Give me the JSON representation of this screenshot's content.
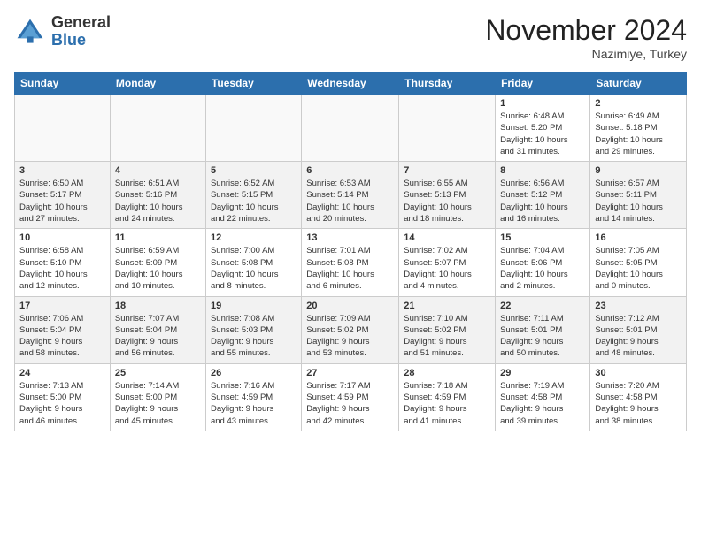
{
  "header": {
    "logo_line1": "General",
    "logo_line2": "Blue",
    "month_year": "November 2024",
    "location": "Nazimiye, Turkey"
  },
  "weekdays": [
    "Sunday",
    "Monday",
    "Tuesday",
    "Wednesday",
    "Thursday",
    "Friday",
    "Saturday"
  ],
  "weeks": [
    [
      {
        "day": "",
        "info": ""
      },
      {
        "day": "",
        "info": ""
      },
      {
        "day": "",
        "info": ""
      },
      {
        "day": "",
        "info": ""
      },
      {
        "day": "",
        "info": ""
      },
      {
        "day": "1",
        "info": "Sunrise: 6:48 AM\nSunset: 5:20 PM\nDaylight: 10 hours\nand 31 minutes."
      },
      {
        "day": "2",
        "info": "Sunrise: 6:49 AM\nSunset: 5:18 PM\nDaylight: 10 hours\nand 29 minutes."
      }
    ],
    [
      {
        "day": "3",
        "info": "Sunrise: 6:50 AM\nSunset: 5:17 PM\nDaylight: 10 hours\nand 27 minutes."
      },
      {
        "day": "4",
        "info": "Sunrise: 6:51 AM\nSunset: 5:16 PM\nDaylight: 10 hours\nand 24 minutes."
      },
      {
        "day": "5",
        "info": "Sunrise: 6:52 AM\nSunset: 5:15 PM\nDaylight: 10 hours\nand 22 minutes."
      },
      {
        "day": "6",
        "info": "Sunrise: 6:53 AM\nSunset: 5:14 PM\nDaylight: 10 hours\nand 20 minutes."
      },
      {
        "day": "7",
        "info": "Sunrise: 6:55 AM\nSunset: 5:13 PM\nDaylight: 10 hours\nand 18 minutes."
      },
      {
        "day": "8",
        "info": "Sunrise: 6:56 AM\nSunset: 5:12 PM\nDaylight: 10 hours\nand 16 minutes."
      },
      {
        "day": "9",
        "info": "Sunrise: 6:57 AM\nSunset: 5:11 PM\nDaylight: 10 hours\nand 14 minutes."
      }
    ],
    [
      {
        "day": "10",
        "info": "Sunrise: 6:58 AM\nSunset: 5:10 PM\nDaylight: 10 hours\nand 12 minutes."
      },
      {
        "day": "11",
        "info": "Sunrise: 6:59 AM\nSunset: 5:09 PM\nDaylight: 10 hours\nand 10 minutes."
      },
      {
        "day": "12",
        "info": "Sunrise: 7:00 AM\nSunset: 5:08 PM\nDaylight: 10 hours\nand 8 minutes."
      },
      {
        "day": "13",
        "info": "Sunrise: 7:01 AM\nSunset: 5:08 PM\nDaylight: 10 hours\nand 6 minutes."
      },
      {
        "day": "14",
        "info": "Sunrise: 7:02 AM\nSunset: 5:07 PM\nDaylight: 10 hours\nand 4 minutes."
      },
      {
        "day": "15",
        "info": "Sunrise: 7:04 AM\nSunset: 5:06 PM\nDaylight: 10 hours\nand 2 minutes."
      },
      {
        "day": "16",
        "info": "Sunrise: 7:05 AM\nSunset: 5:05 PM\nDaylight: 10 hours\nand 0 minutes."
      }
    ],
    [
      {
        "day": "17",
        "info": "Sunrise: 7:06 AM\nSunset: 5:04 PM\nDaylight: 9 hours\nand 58 minutes."
      },
      {
        "day": "18",
        "info": "Sunrise: 7:07 AM\nSunset: 5:04 PM\nDaylight: 9 hours\nand 56 minutes."
      },
      {
        "day": "19",
        "info": "Sunrise: 7:08 AM\nSunset: 5:03 PM\nDaylight: 9 hours\nand 55 minutes."
      },
      {
        "day": "20",
        "info": "Sunrise: 7:09 AM\nSunset: 5:02 PM\nDaylight: 9 hours\nand 53 minutes."
      },
      {
        "day": "21",
        "info": "Sunrise: 7:10 AM\nSunset: 5:02 PM\nDaylight: 9 hours\nand 51 minutes."
      },
      {
        "day": "22",
        "info": "Sunrise: 7:11 AM\nSunset: 5:01 PM\nDaylight: 9 hours\nand 50 minutes."
      },
      {
        "day": "23",
        "info": "Sunrise: 7:12 AM\nSunset: 5:01 PM\nDaylight: 9 hours\nand 48 minutes."
      }
    ],
    [
      {
        "day": "24",
        "info": "Sunrise: 7:13 AM\nSunset: 5:00 PM\nDaylight: 9 hours\nand 46 minutes."
      },
      {
        "day": "25",
        "info": "Sunrise: 7:14 AM\nSunset: 5:00 PM\nDaylight: 9 hours\nand 45 minutes."
      },
      {
        "day": "26",
        "info": "Sunrise: 7:16 AM\nSunset: 4:59 PM\nDaylight: 9 hours\nand 43 minutes."
      },
      {
        "day": "27",
        "info": "Sunrise: 7:17 AM\nSunset: 4:59 PM\nDaylight: 9 hours\nand 42 minutes."
      },
      {
        "day": "28",
        "info": "Sunrise: 7:18 AM\nSunset: 4:59 PM\nDaylight: 9 hours\nand 41 minutes."
      },
      {
        "day": "29",
        "info": "Sunrise: 7:19 AM\nSunset: 4:58 PM\nDaylight: 9 hours\nand 39 minutes."
      },
      {
        "day": "30",
        "info": "Sunrise: 7:20 AM\nSunset: 4:58 PM\nDaylight: 9 hours\nand 38 minutes."
      }
    ]
  ]
}
